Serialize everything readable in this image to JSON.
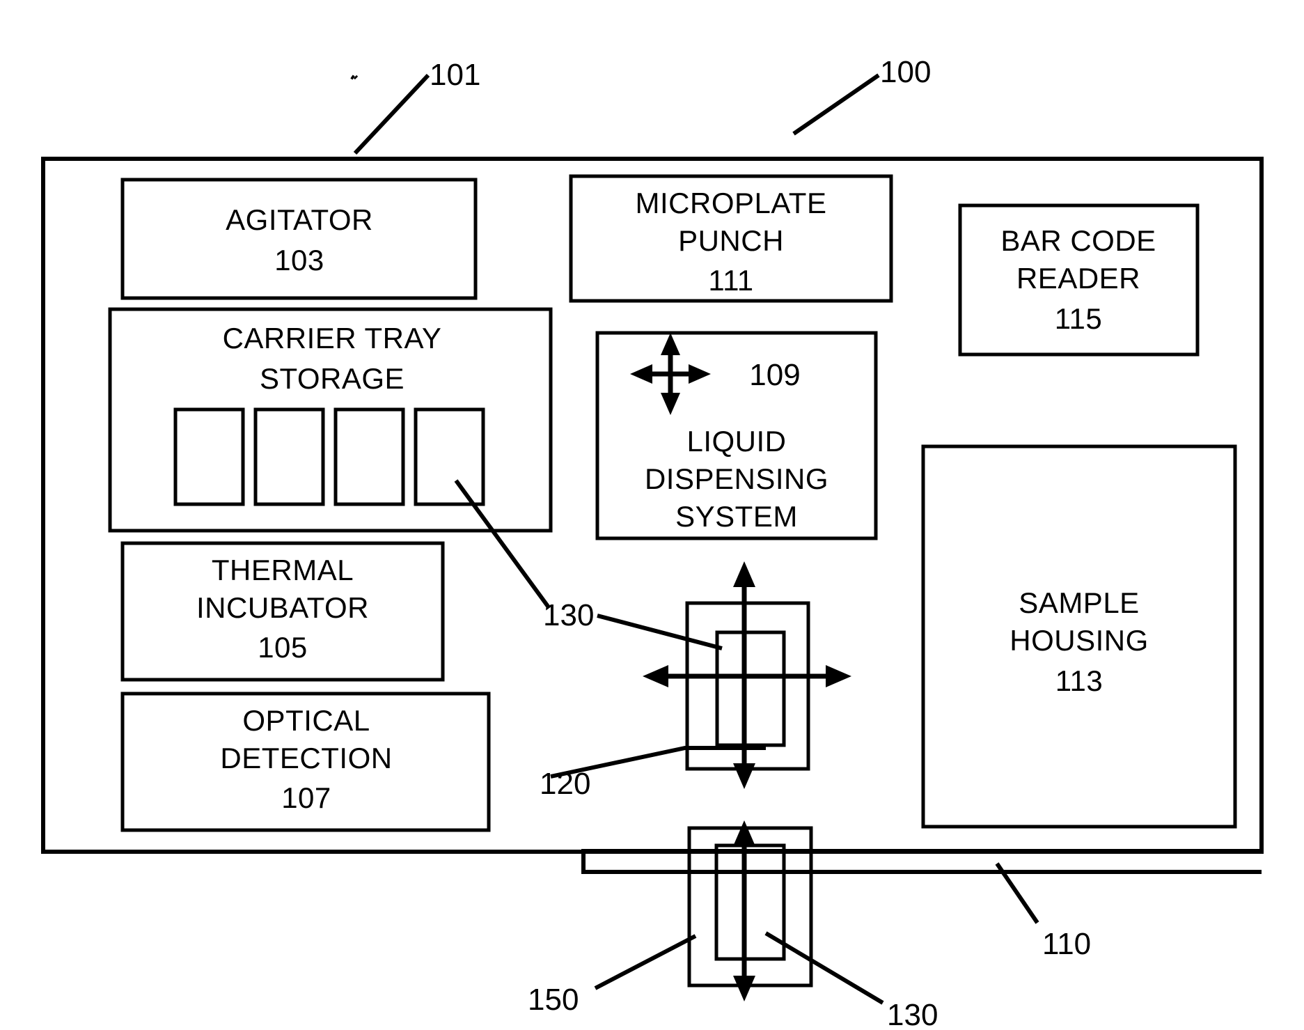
{
  "figure": {
    "title": "Automated sample processing instrument block diagram",
    "background_color": "#ffffff",
    "line_color": "#000000"
  },
  "reference_numerals": {
    "instrument_housing": "101",
    "figure_overall": "100",
    "agitator": "103",
    "carrier_tray_storage": "",
    "thermal_incubator": "105",
    "optical_detection": "107",
    "liquid_dispensing_system": "109",
    "microplate_punch": "111",
    "sample_housing": "113",
    "bar_code_reader": "115",
    "conveyor_track": "110",
    "upper_gripper": "120",
    "gripper_jaw_upper": "130",
    "lower_gripper": "150",
    "gripper_jaw_lower": "130"
  },
  "blocks": [
    {
      "id": "agitator",
      "name": "agitator-block",
      "lines": [
        "AGITATOR",
        "103"
      ]
    },
    {
      "id": "carrier_tray_storage",
      "name": "carrier-tray-storage-block",
      "lines": [
        "CARRIER TRAY",
        "STORAGE"
      ],
      "slots": 4
    },
    {
      "id": "thermal_incubator",
      "name": "thermal-incubator-block",
      "lines": [
        "THERMAL",
        "INCUBATOR",
        "105"
      ]
    },
    {
      "id": "optical_detection",
      "name": "optical-detection-block",
      "lines": [
        "OPTICAL",
        "DETECTION",
        "107"
      ]
    },
    {
      "id": "microplate_punch",
      "name": "microplate-punch-block",
      "lines": [
        "MICROPLATE",
        "PUNCH",
        "111"
      ]
    },
    {
      "id": "liquid_dispensing_system",
      "name": "liquid-dispensing-system-block",
      "lines": [
        "LIQUID",
        "DISPENSING",
        "SYSTEM"
      ],
      "badge": "109"
    },
    {
      "id": "bar_code_reader",
      "name": "bar-code-reader-block",
      "lines": [
        "BAR CODE",
        "READER",
        "115"
      ]
    },
    {
      "id": "sample_housing",
      "name": "sample-housing-block",
      "lines": [
        "SAMPLE",
        "HOUSING",
        "113"
      ]
    }
  ],
  "text": {
    "agitator_line1": "AGITATOR",
    "agitator_line2": "103",
    "carrier_line1": "CARRIER TRAY",
    "carrier_line2": "STORAGE",
    "thermal_line1": "THERMAL",
    "thermal_line2": "INCUBATOR",
    "thermal_line3": "105",
    "optical_line1": "OPTICAL",
    "optical_line2": "DETECTION",
    "optical_line3": "107",
    "punch_line1": "MICROPLATE",
    "punch_line2": "PUNCH",
    "punch_line3": "111",
    "liquid_badge": "109",
    "liquid_line1": "LIQUID",
    "liquid_line2": "DISPENSING",
    "liquid_line3": "SYSTEM",
    "barcode_line1": "BAR CODE",
    "barcode_line2": "READER",
    "barcode_line3": "115",
    "sample_line1": "SAMPLE",
    "sample_line2": "HOUSING",
    "sample_line3": "113",
    "ref_101": "101",
    "ref_100": "100",
    "ref_130_upper": "130",
    "ref_120": "120",
    "ref_150": "150",
    "ref_130_lower": "130",
    "ref_110": "110"
  }
}
